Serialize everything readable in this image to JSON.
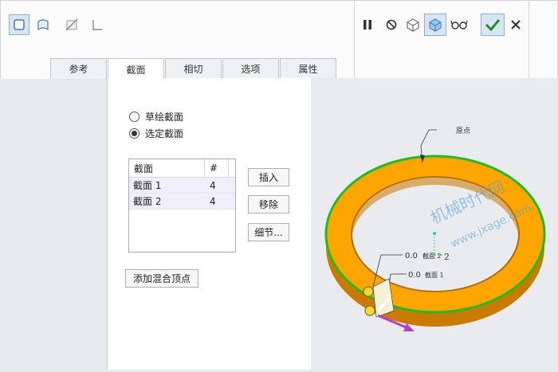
{
  "tabs": [
    {
      "label": "参考"
    },
    {
      "label": "截面"
    },
    {
      "label": "相切"
    },
    {
      "label": "选项"
    },
    {
      "label": "属性"
    }
  ],
  "active_tab": "截面",
  "section": {
    "radio_sketch": "草绘截面",
    "radio_selected": "选定截面",
    "selected": "选定截面",
    "table": {
      "headers": [
        "截面",
        "#"
      ],
      "rows": [
        {
          "name": "截面 1",
          "count": "4"
        },
        {
          "name": "截面 2",
          "count": "4"
        }
      ]
    },
    "insert_label": "插入",
    "remove_label": "移除",
    "detail_label": "细节...",
    "add_vertex_label": "添加混合顶点"
  },
  "viewport": {
    "origin_label": "原点",
    "watermark_text": "机械时代网",
    "watermark_url": "www.jxage.com",
    "dim1": "0.0",
    "dim1_tag": "截面 2",
    "dim2": "0.0",
    "dim2_tag": "截面 1",
    "axis_label": "2"
  },
  "colors": {
    "ring": "#ffa500",
    "ring_dark": "#c97a00",
    "edge": "#22bb22",
    "accent": "#3b9bdc",
    "confirm": "#2a8a2a"
  }
}
